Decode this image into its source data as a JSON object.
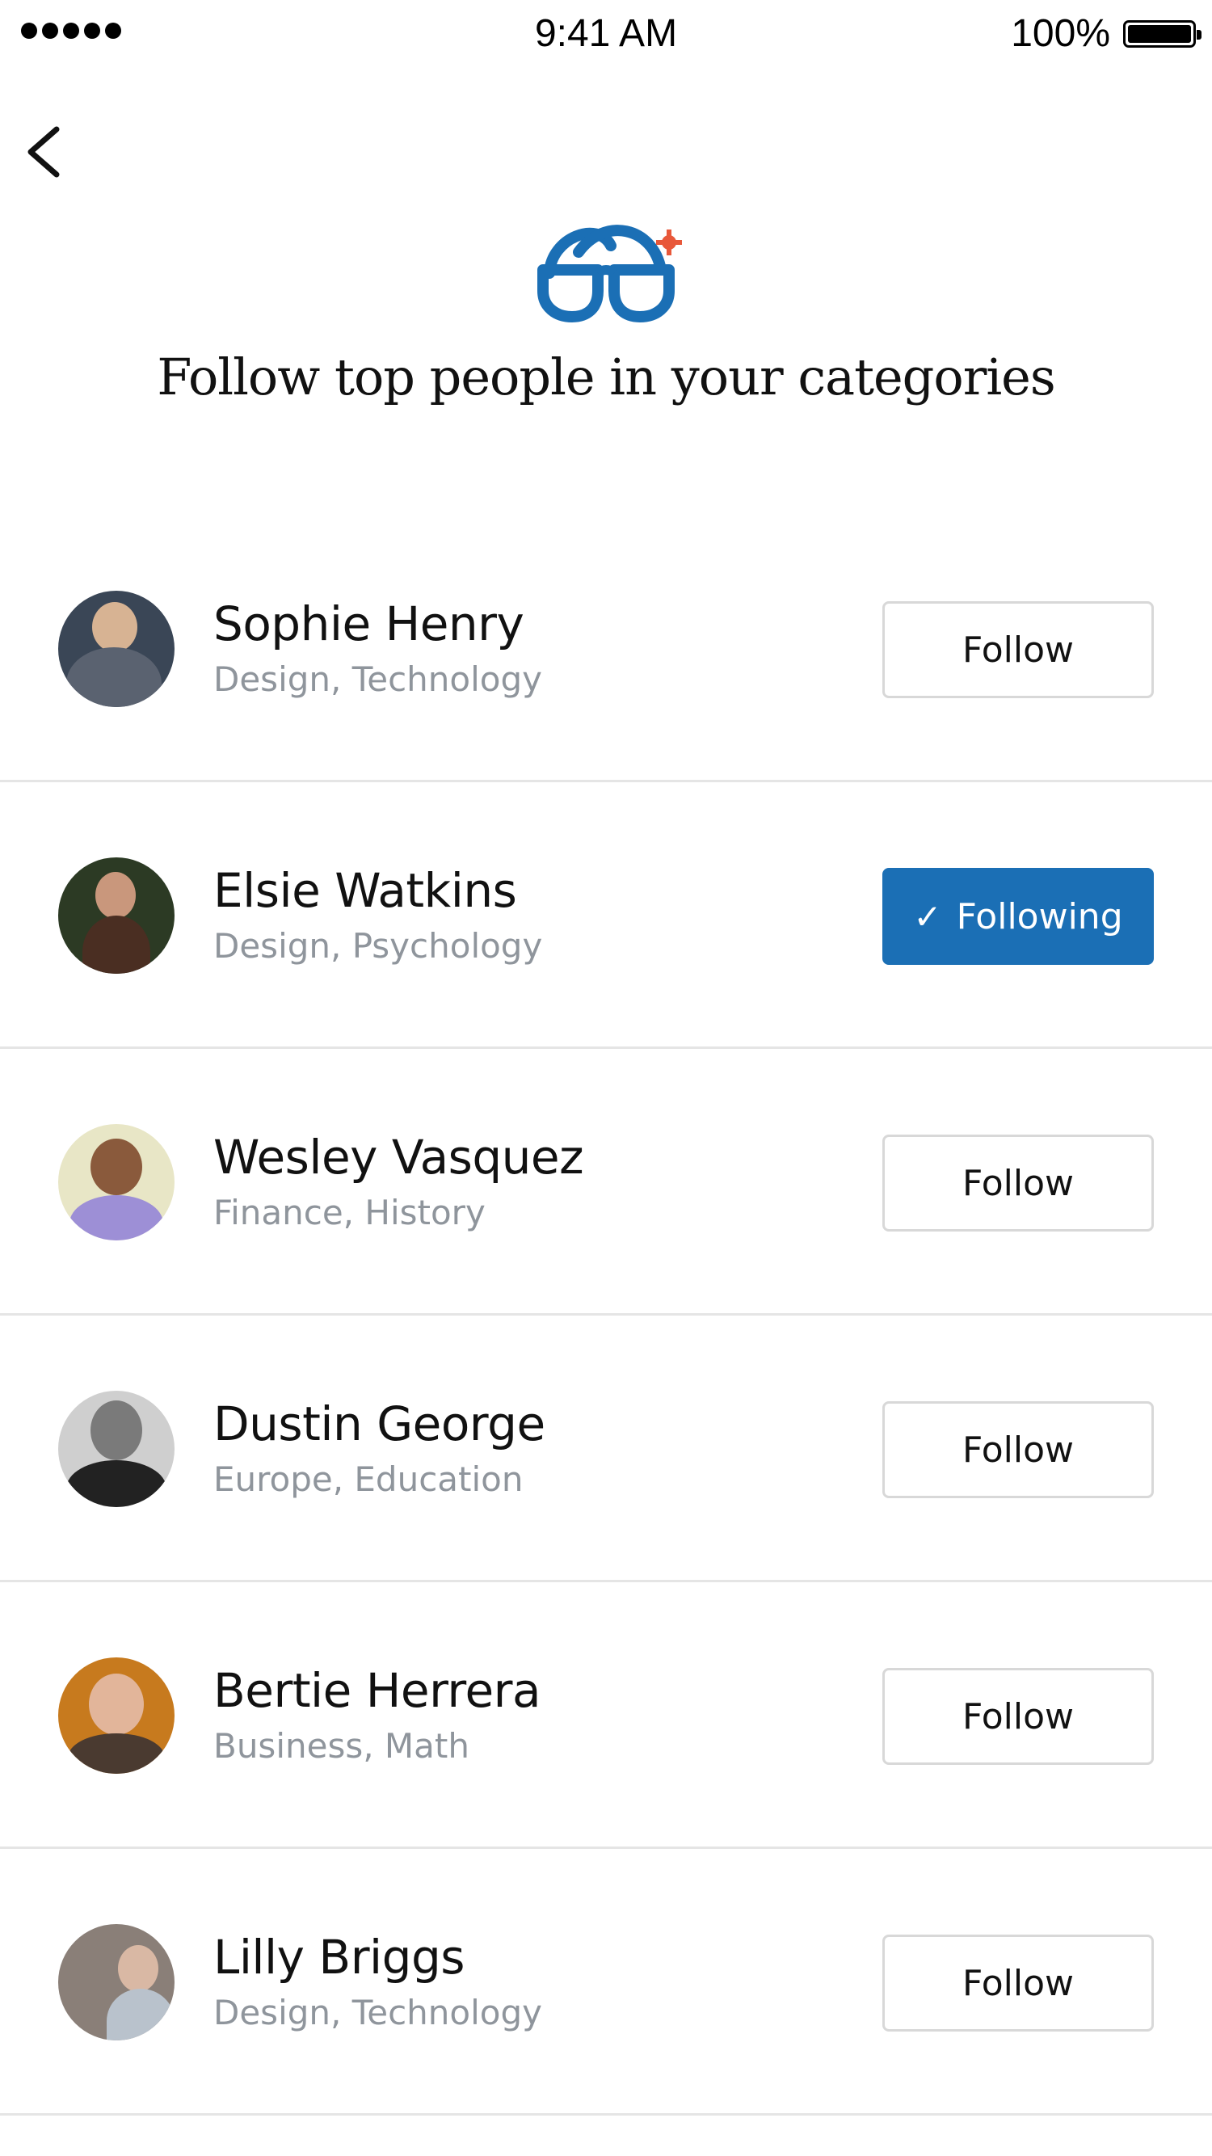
{
  "status_bar": {
    "time": "9:41 AM",
    "battery": "100%"
  },
  "nav": {
    "back_icon": "chevron-left-icon"
  },
  "logo": {
    "icon": "glasses-icon",
    "primary_color": "#1b6fb5",
    "accent_color": "#e8583a"
  },
  "heading": "Follow top people in your categories",
  "people": [
    {
      "name": "Sophie Henry",
      "categories": "Design, Technology",
      "button": "Follow",
      "following": false
    },
    {
      "name": "Elsie Watkins",
      "categories": "Design, Psychology",
      "button": "Following",
      "following": true
    },
    {
      "name": "Wesley Vasquez",
      "categories": "Finance, History",
      "button": "Follow",
      "following": false
    },
    {
      "name": "Dustin George",
      "categories": "Europe, Education",
      "button": "Follow",
      "following": false
    },
    {
      "name": "Bertie Herrera",
      "categories": "Business, Math",
      "button": "Follow",
      "following": false
    },
    {
      "name": "Lilly Briggs",
      "categories": "Design, Technology",
      "button": "Follow",
      "following": false
    }
  ],
  "colors": {
    "accent": "#1b6fb5",
    "secondary_text": "#8f959c",
    "divider": "#e5e5e5"
  }
}
